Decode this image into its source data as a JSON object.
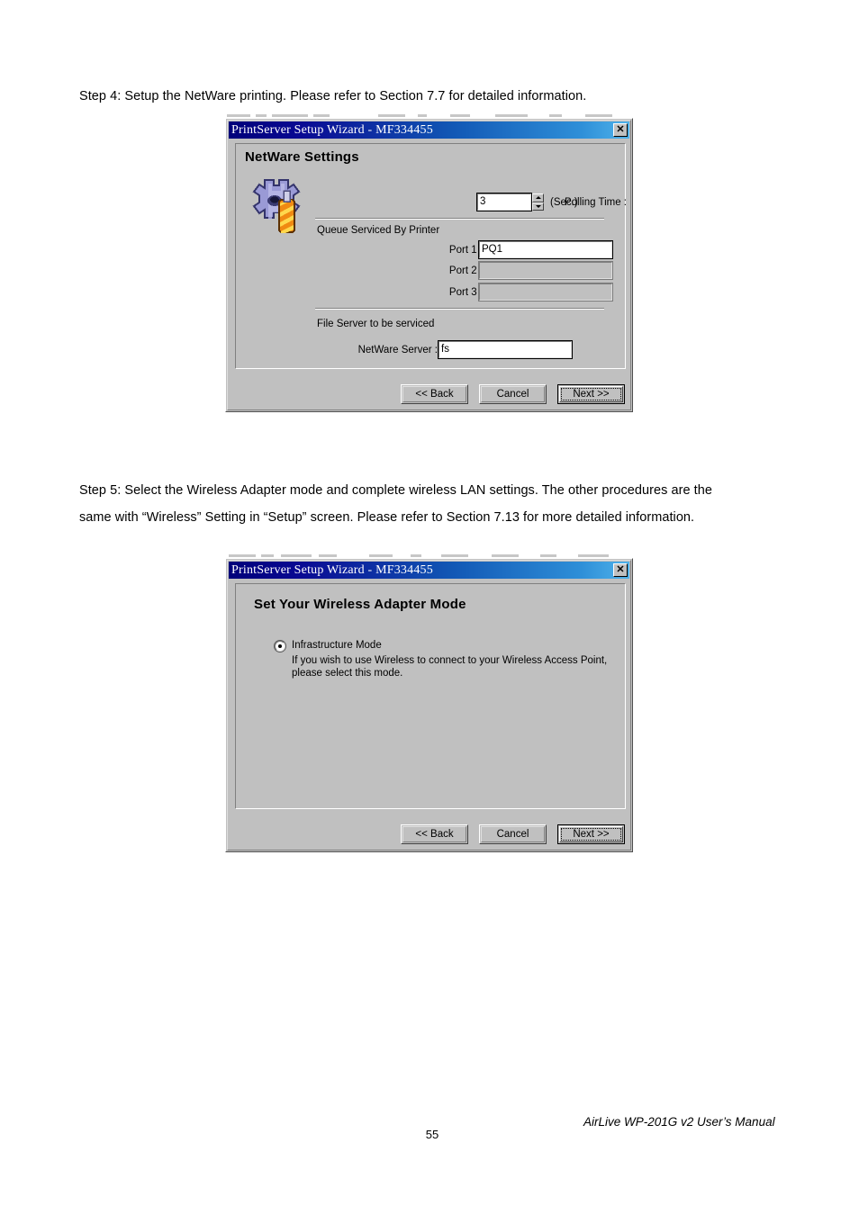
{
  "document": {
    "step4_text": "Step 4: Setup the NetWare printing. Please refer to Section 7.7 for detailed information.",
    "step5_line1": "Step 5: Select the Wireless Adapter mode and complete wireless LAN settings. The other procedures are the",
    "step5_line2": "same with “Wireless” Setting in “Setup” screen. Please refer to Section 7.13 for more detailed information.",
    "page_number": "55",
    "manual_footer": "AirLive WP-201G v2 User’s Manual"
  },
  "dialog_netware": {
    "titlebar": {
      "title": "PrintServer Setup Wizard - MF334455",
      "close_label": "✕"
    },
    "heading": "NetWare Settings",
    "polling": {
      "label": "Polling Time :",
      "value": "3",
      "unit": "(Sec.)"
    },
    "queue_section_label": "Queue Serviced By Printer",
    "ports": [
      {
        "label": "Port 1 :",
        "value": "PQ1",
        "disabled": false
      },
      {
        "label": "Port 2 :",
        "value": "",
        "disabled": true
      },
      {
        "label": "Port 3 :",
        "value": "",
        "disabled": true
      }
    ],
    "fileserver_section_label": "File Server to be serviced",
    "netware_server": {
      "label": "NetWare Server :",
      "value": "fs"
    },
    "buttons": {
      "back": "<< Back",
      "cancel": "Cancel",
      "next": "Next >>"
    }
  },
  "dialog_wireless": {
    "titlebar": {
      "title": "PrintServer Setup Wizard - MF334455",
      "close_label": "✕"
    },
    "heading": "Set Your Wireless Adapter Mode",
    "mode_option": {
      "label": "Infrastructure Mode",
      "desc_line1": "If you wish to use Wireless to connect to your Wireless Access Point,",
      "desc_line2": "please select this mode."
    },
    "buttons": {
      "back": "<< Back",
      "cancel": "Cancel",
      "next": "Next >>"
    }
  },
  "colors": {
    "dialog_face": "#c0c0c0",
    "titlebar_start": "#00007a",
    "titlebar_end": "#4fb2ea",
    "field_bg": "#ffffff",
    "text": "#000000"
  }
}
